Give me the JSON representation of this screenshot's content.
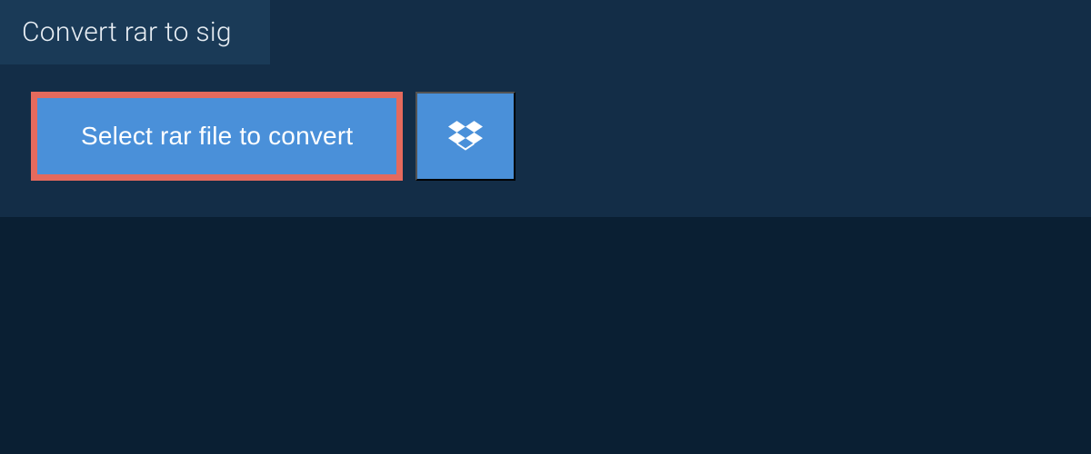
{
  "tab": {
    "title": "Convert rar to sig"
  },
  "buttons": {
    "select_file_label": "Select rar file to convert"
  }
}
